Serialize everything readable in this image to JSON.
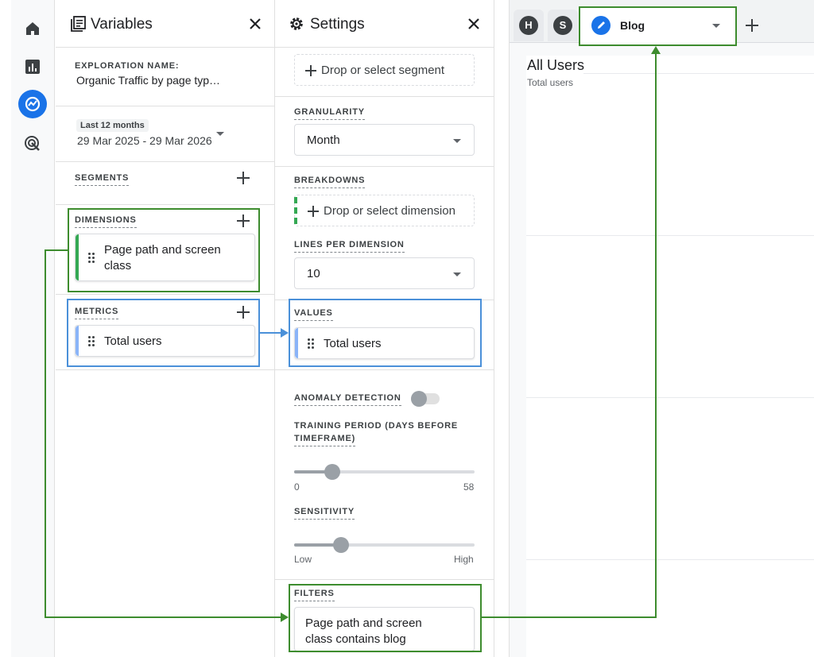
{
  "nav_rail": {
    "items": [
      {
        "name": "home-icon"
      },
      {
        "name": "reports-icon"
      },
      {
        "name": "explore-icon",
        "active": true
      },
      {
        "name": "advertising-icon"
      }
    ]
  },
  "variables": {
    "title": "Variables",
    "exploration_name_label": "EXPLORATION NAME:",
    "exploration_name": "Organic Traffic by page typ…",
    "date_chip": "Last 12 months",
    "date_range": "29 Mar 2025 - 29 Mar 2026",
    "segments_label": "SEGMENTS",
    "dimensions_label": "DIMENSIONS",
    "dimension_line1": "Page path and screen",
    "dimension_line2": "class",
    "metrics_label": "METRICS",
    "metric_item": "Total users"
  },
  "settings": {
    "title": "Settings",
    "segment_drop": "Drop or select segment",
    "granularity_label": "GRANULARITY",
    "granularity_value": "Month",
    "breakdowns_label": "BREAKDOWNS",
    "breakdown_drop": "Drop or select dimension",
    "lines_label": "LINES PER DIMENSION",
    "lines_value": "10",
    "values_label": "VALUES",
    "values_item": "Total users",
    "anomaly_label": "ANOMALY DETECTION",
    "anomaly_enabled": false,
    "training_label_1": "TRAINING PERIOD (DAYS BEFORE",
    "training_label_2": "TIMEFRAME)",
    "training_min": "0",
    "training_max": "58",
    "training_fraction": 0.21,
    "sensitivity_label": "SENSITIVITY",
    "sensitivity_min": "Low",
    "sensitivity_max": "High",
    "sensitivity_fraction": 0.26,
    "filters_label": "FILTERS",
    "filter_line1": "Page path and screen",
    "filter_line2": "class contains blog"
  },
  "canvas": {
    "tabs": [
      {
        "letter": "H"
      },
      {
        "letter": "S"
      }
    ],
    "active_tab": "Blog",
    "chart_title": "All Users",
    "chart_subtitle": "Total users"
  },
  "colors": {
    "accent_blue": "#1a73e8",
    "highlight_green": "#3d8c2e",
    "highlight_blue": "#4a90d9",
    "dimension_bar": "#34a853",
    "metric_bar": "#8ab4f8"
  }
}
